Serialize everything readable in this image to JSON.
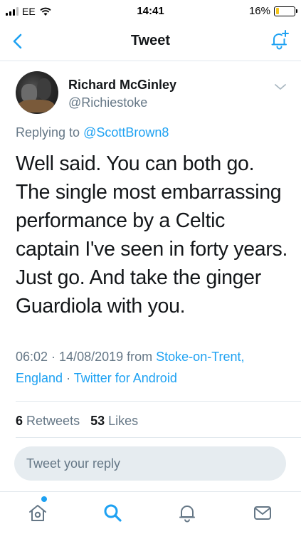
{
  "status_bar": {
    "carrier": "EE",
    "time": "14:41",
    "battery_percent_label": "16%",
    "battery_level": 0.16
  },
  "nav": {
    "title": "Tweet"
  },
  "tweet": {
    "author_name": "Richard McGinley",
    "author_handle": "@Richiestoke",
    "replying_prefix": "Replying to",
    "replying_to": "@ScottBrown8",
    "text": "Well said.  You can both go.\nThe single most embarrassing\nperformance by a Celtic\ncaptain I've seen in forty years.\nJust go. And take the ginger\nGuardiola with you.",
    "time_date": "06:02 · 14/08/2019 from",
    "location": "Stoke-on-Trent, England",
    "separator": "·",
    "client": "Twitter for Android",
    "retweets_count": "6",
    "retweets_label": "Retweets",
    "likes_count": "53",
    "likes_label": "Likes"
  },
  "reply": {
    "placeholder": "Tweet your reply"
  },
  "colors": {
    "accent": "#1da1f2",
    "secondary_text": "#657786",
    "primary_text": "#14171a"
  }
}
